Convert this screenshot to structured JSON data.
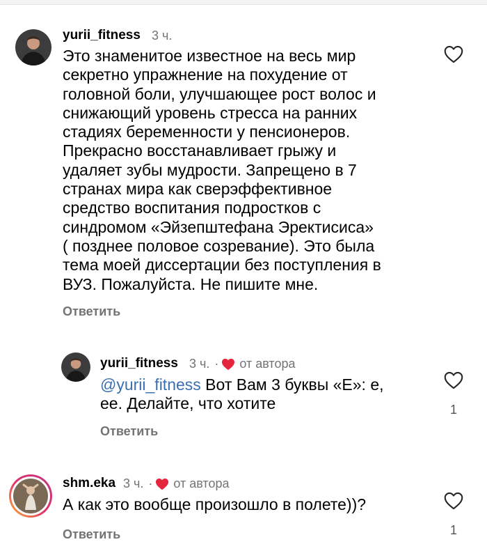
{
  "colors": {
    "text": "#000000",
    "meta": "#737373",
    "mention": "#3a6fb0",
    "heart_red": "#e5243d"
  },
  "comments": [
    {
      "username": "yurii_fitness",
      "time": "3 ч.",
      "lines": [
        "Это знаменитое известное на весь мир",
        "секретно упражнение на похудение от",
        "головной боли, улучшающее рост волос и",
        "снижающий уровень стресса на ранних",
        "стадиях беременности у пенсионеров.",
        "Прекрасно восстанавливает грыжу и",
        "удаляет зубы мудрости. Запрещено в 7",
        "странах мира как сверэффективное",
        "средство воспитания подростков с",
        "синдромом «Эйзепштефана Эректисиса»",
        "( позднее половое созревание). Это была",
        "тема моей диссертации без поступления в",
        "ВУЗ. Пожалуйста. Не пишите мне."
      ],
      "reply_label": "Ответить",
      "like_icon": "heart-outline-icon"
    },
    {
      "username": "yurii_fitness",
      "time": "3 ч.",
      "separator": "·",
      "liked_by_author_icon": "heart-filled-icon",
      "by_author": "от автора",
      "mention": "@yurii_fitness",
      "line1_rest": " Вот Вам 3 буквы «Е»: е,",
      "line2": "ее. Делайте, что хотите",
      "reply_label": "Ответить",
      "like_icon": "heart-outline-icon",
      "likes": "1"
    },
    {
      "username": "shm.eka",
      "time": "3 ч.",
      "separator": "·",
      "liked_by_author_icon": "heart-filled-icon",
      "by_author": "от автора",
      "text": "А как это вообще произошло в полете))?",
      "reply_label": "Ответить",
      "like_icon": "heart-outline-icon",
      "likes": "1"
    }
  ]
}
